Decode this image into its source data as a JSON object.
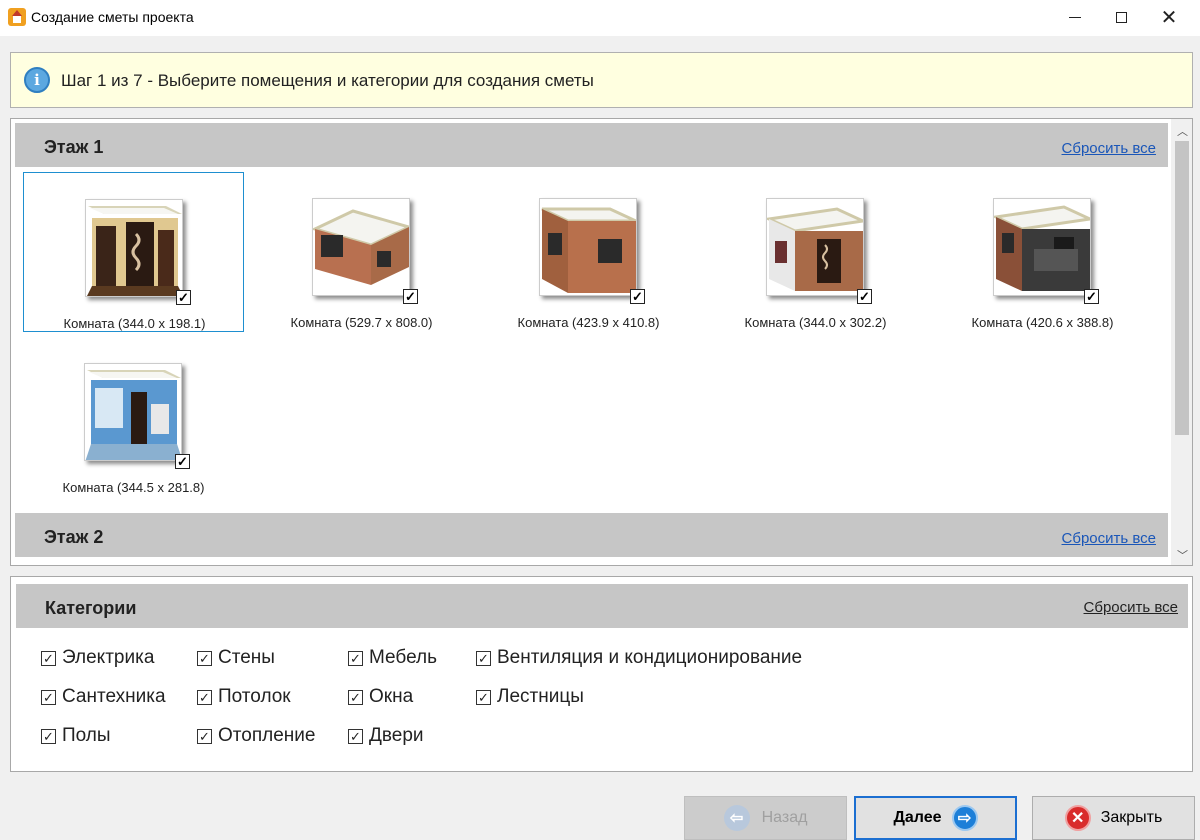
{
  "window": {
    "title": "Создание сметы проекта",
    "minimize_glyph": "",
    "close_glyph": "✕"
  },
  "info": {
    "icon": "info-icon",
    "icon_glyph": "i",
    "text": "Шаг 1 из 7 - Выберите помещения и категории для создания сметы"
  },
  "floors": [
    {
      "title": "Этаж 1",
      "reset_label": "Сбросить все",
      "rooms": [
        {
          "label": "Комната (344.0 x 198.1)",
          "checked": true,
          "selected": true
        },
        {
          "label": "Комната (529.7 x 808.0)",
          "checked": true,
          "selected": false
        },
        {
          "label": "Комната (423.9 x 410.8)",
          "checked": true,
          "selected": false
        },
        {
          "label": "Комната (344.0 x 302.2)",
          "checked": true,
          "selected": false
        },
        {
          "label": "Комната (420.6 x 388.8)",
          "checked": true,
          "selected": false
        },
        {
          "label": "Комната (344.5 x 281.8)",
          "checked": true,
          "selected": false
        }
      ]
    },
    {
      "title": "Этаж 2",
      "reset_label": "Сбросить все"
    }
  ],
  "check_glyph": "✓",
  "categories": {
    "title": "Категории",
    "reset_label": "Сбросить все",
    "items": [
      {
        "label": "Электрика",
        "checked": true
      },
      {
        "label": "Сантехника",
        "checked": true
      },
      {
        "label": "Полы",
        "checked": true
      },
      {
        "label": "Стены",
        "checked": true
      },
      {
        "label": "Потолок",
        "checked": true
      },
      {
        "label": "Отопление",
        "checked": true
      },
      {
        "label": "Мебель",
        "checked": true
      },
      {
        "label": "Окна",
        "checked": true
      },
      {
        "label": "Двери",
        "checked": true
      },
      {
        "label": "Вентиляция и кондиционирование",
        "checked": true
      },
      {
        "label": "Лестницы",
        "checked": true
      }
    ]
  },
  "buttons": {
    "back_label": "Назад",
    "back_enabled": false,
    "back_glyph": "⇦",
    "next_label": "Далее",
    "next_glyph": "⇨",
    "close_label": "Закрыть",
    "close_glyph": "✕"
  }
}
